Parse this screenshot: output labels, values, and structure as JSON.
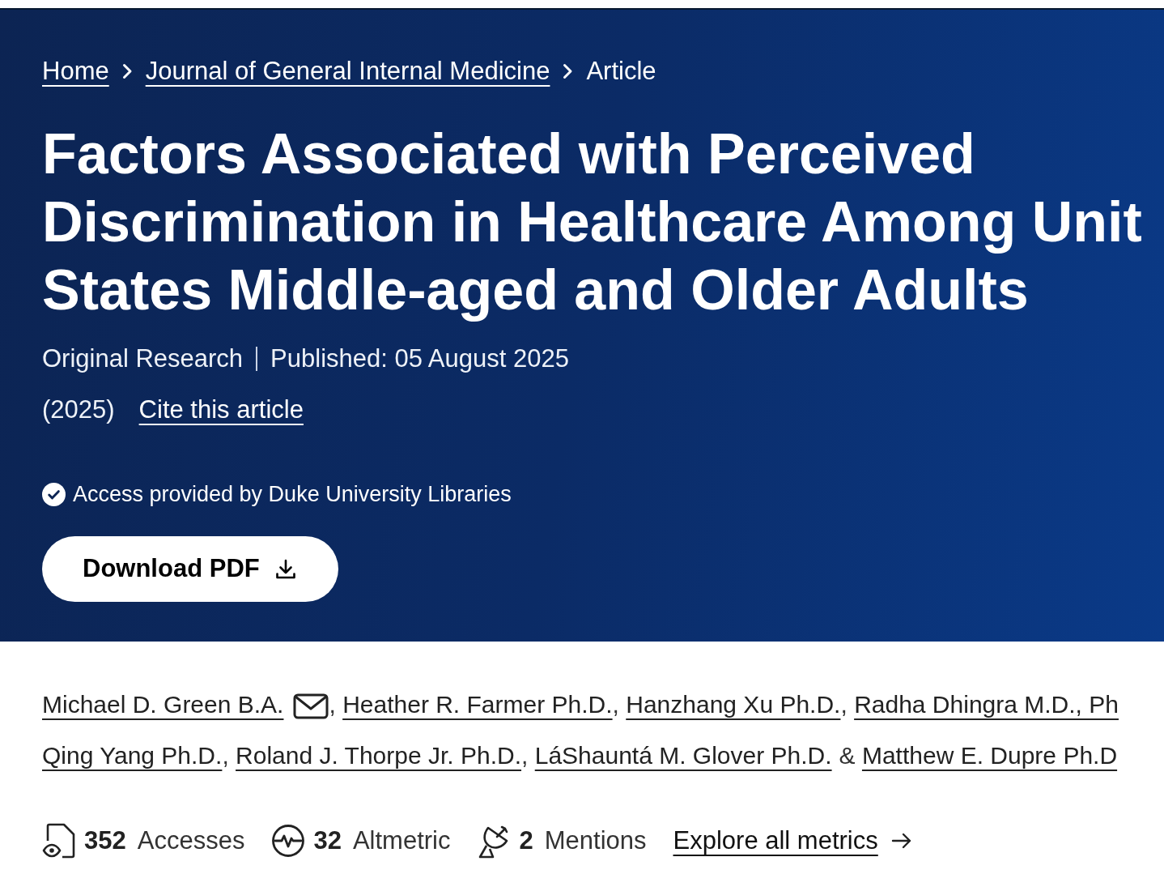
{
  "breadcrumb": [
    {
      "label": "Home",
      "kind": "link"
    },
    {
      "label": "Journal of General Internal Medicine",
      "kind": "link"
    },
    {
      "label": "Article",
      "kind": "current"
    }
  ],
  "title_lines": [
    "Factors Associated with Perceived",
    "Discrimination in Healthcare Among Unit",
    "States Middle-aged and Older Adults"
  ],
  "article_type": "Original Research",
  "published": "Published: 05 August 2025",
  "year": "(2025)",
  "cite_link": "Cite this article",
  "access_text": "Access provided by Duke University Libraries",
  "download_button": "Download PDF",
  "author_lines": [
    [
      {
        "name": "Michael D. Green B.A.",
        "email": true,
        "sep": ","
      },
      {
        "name": "Heather R. Farmer Ph.D.",
        "email": false,
        "sep": ","
      },
      {
        "name": "Hanzhang Xu Ph.D.",
        "email": false,
        "sep": ","
      },
      {
        "name": "Radha Dhingra M.D., Ph",
        "email": false
      }
    ],
    [
      {
        "name": "Qing Yang Ph.D.",
        "email": false,
        "sep": ","
      },
      {
        "name": "Roland J. Thorpe Jr. Ph.D.",
        "email": false,
        "sep": ","
      },
      {
        "name": "LáShauntá M. Glover Ph.D.",
        "email": false,
        "sep": "&"
      },
      {
        "name": "Matthew E. Dupre Ph.D",
        "email": false
      }
    ]
  ],
  "metrics": [
    {
      "kind": "accesses",
      "value": "352",
      "label": "Accesses"
    },
    {
      "kind": "altmetric",
      "value": "32",
      "label": "Altmetric"
    },
    {
      "kind": "mentions",
      "value": "2",
      "label": "Mentions"
    }
  ],
  "explore_link": "Explore all metrics"
}
